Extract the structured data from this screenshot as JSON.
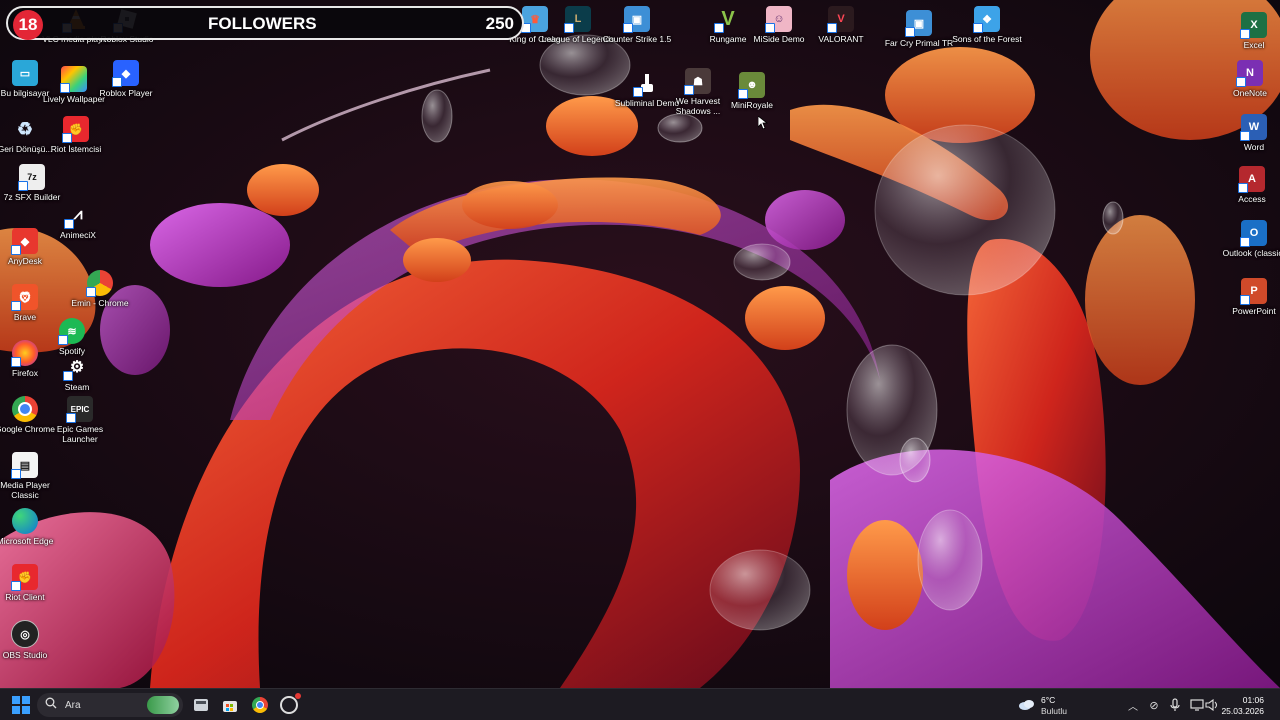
{
  "followers_widget": {
    "count": "18",
    "title": "FOLLOWERS",
    "goal": "250"
  },
  "desktop_icons": {
    "vlc": "VLC media player",
    "roblox_studio": "Roblox Studio",
    "king_of_crabs": "King of Crabs",
    "league": "League of Legends",
    "counter_strike": "Counter Strike 1.5",
    "rungame": "Rungame",
    "miside": "MiSide Demo",
    "valorant": "VALORANT",
    "far_cry": "Far Cry Primal TR",
    "sons_forest": "Sons of the Forest",
    "excel": "Excel",
    "bu_bilgisayar": "Bu bilgisayar",
    "lively": "Lively Wallpaper",
    "roblox_player": "Roblox Player",
    "subliminal": "Subliminal Demo",
    "we_harvest": "We Harvest Shadows ...",
    "miniroyale": "MiniRoyale",
    "onenote": "OneNote",
    "geri_donusum": "Geri Dönüşü...",
    "riot_istemcisi": "Riot İstemcisi",
    "word": "Word",
    "sfx_builder": "7z SFX Builder",
    "access": "Access",
    "animecix": "AnimeciX",
    "anydesk": "AnyDesk",
    "outlook": "Outlook (classic)",
    "emin_chrome": "Emin - Chrome",
    "brave": "Brave",
    "powerpoint": "PowerPoint",
    "spotify": "Spotify",
    "firefox": "Firefox",
    "steam": "Steam",
    "google_chrome": "Google Chrome",
    "epic": "Epic Games Launcher",
    "mpc": "Media Player Classic",
    "edge": "Microsoft Edge",
    "riot_client": "Riot Client",
    "obs": "OBS Studio"
  },
  "icon_glyphs": {
    "epic": "EPIC",
    "sfx": "7z"
  },
  "taskbar": {
    "search_placeholder": "Ara",
    "weather_temp": "6°C",
    "weather_condition": "Bulutlu",
    "time": "01:06",
    "date": "25.03.2026"
  },
  "colors": {
    "followers_badge": "#e32636",
    "taskbar_bg": "#1d1b22",
    "wallpaper_bg": "#120912"
  }
}
